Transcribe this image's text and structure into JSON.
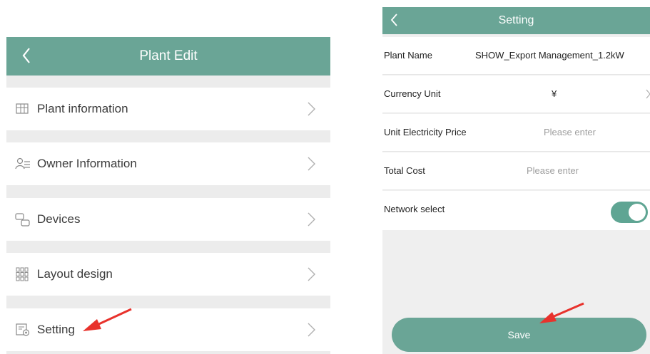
{
  "plant_edit": {
    "title": "Plant Edit",
    "items": [
      {
        "label": "Plant information",
        "icon": "plant-info-icon"
      },
      {
        "label": "Owner Information",
        "icon": "owner-icon"
      },
      {
        "label": "Devices",
        "icon": "devices-icon"
      },
      {
        "label": "Layout design",
        "icon": "layout-icon"
      },
      {
        "label": "Setting",
        "icon": "setting-icon"
      }
    ]
  },
  "setting": {
    "title": "Setting",
    "plant_name_label": "Plant Name",
    "plant_name_value": "SHOW_Export Management_1.2kW",
    "currency_label": "Currency Unit",
    "currency_value": "¥",
    "price_label": "Unit Electricity Price",
    "price_placeholder": "Please enter",
    "cost_label": "Total Cost",
    "cost_placeholder": "Please enter",
    "network_label": "Network select",
    "network_enabled": true,
    "save_label": "Save"
  },
  "colors": {
    "header": "#6aa596",
    "toggle_on": "#5fa593",
    "annotation_arrow": "#e8322c"
  }
}
